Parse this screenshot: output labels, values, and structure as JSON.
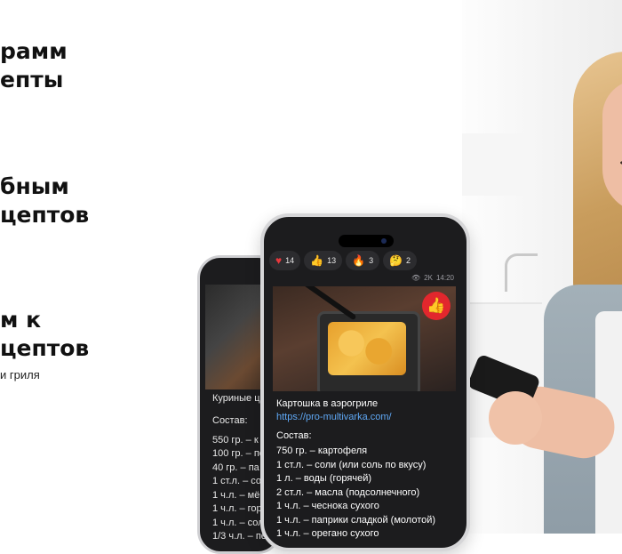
{
  "headings": {
    "h1": [
      "рамм",
      "епты"
    ],
    "h2": [
      "бным",
      "цептов"
    ],
    "h3": [
      "м к",
      "цептов"
    ],
    "caption": "и гриля"
  },
  "back_phone": {
    "title": "Куриные ц",
    "section": "Состав:",
    "items": [
      "550 гр. – к",
      "100 гр. – по",
      "40 гр. – па",
      "1 ст.л. – со",
      "1 ч.л. – мё",
      "1 ч.л. – гор",
      "1 ч.л. – сол",
      "1/3 ч.л. – пе"
    ]
  },
  "front_phone": {
    "reactions": [
      {
        "icon": "heart-icon",
        "count": "14"
      },
      {
        "icon": "thumbs-up-icon",
        "count": "13"
      },
      {
        "icon": "fire-icon",
        "count": "3"
      },
      {
        "icon": "thinking-face-icon",
        "count": "2"
      }
    ],
    "views": "2K",
    "time": "14:20",
    "post_title": "Картошка в аэрогриле",
    "post_link": "https://pro-multivarka.com/",
    "section": "Состав:",
    "ingredients": [
      "750 гр. – картофеля",
      "1 ст.л. – соли (или соль по вкусу)",
      "1 л. – воды (горячей)",
      "2 ст.л. – масла (подсолнечного)",
      "1 ч.л. – чеснока сухого",
      "1 ч.л. – паприки сладкой (молотой)",
      "1 ч.л. – орегано сухого"
    ]
  },
  "colors": {
    "phone_bg": "#1c1c1e",
    "link": "#5fa8f5",
    "like_badge": "#e2272d"
  }
}
